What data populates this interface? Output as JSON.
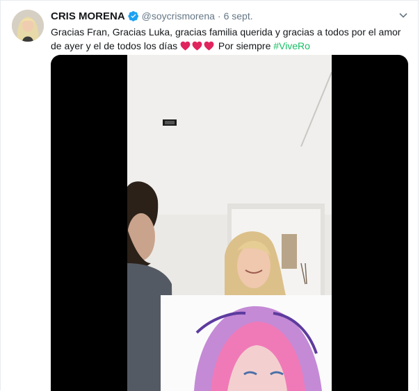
{
  "tweet": {
    "display_name": "CRIS MORENA",
    "handle": "@soycrismorena",
    "separator": "·",
    "date": "6 sept.",
    "text_part1": "Gracias Fran, Gracias Luka, gracias familia querida y gracias a todos por el amor de ayer y el de todos los días",
    "text_part2": "Por siempre",
    "hashtag": "#ViveRo",
    "heart_count": 3
  },
  "icons": {
    "verified": "verified-badge-icon",
    "caret": "chevron-down-icon",
    "heart": "red-heart-emoji"
  },
  "colors": {
    "hashtag": "#17bf63",
    "verified": "#1da1f2",
    "muted": "#657786",
    "heart": "#e0245e"
  }
}
